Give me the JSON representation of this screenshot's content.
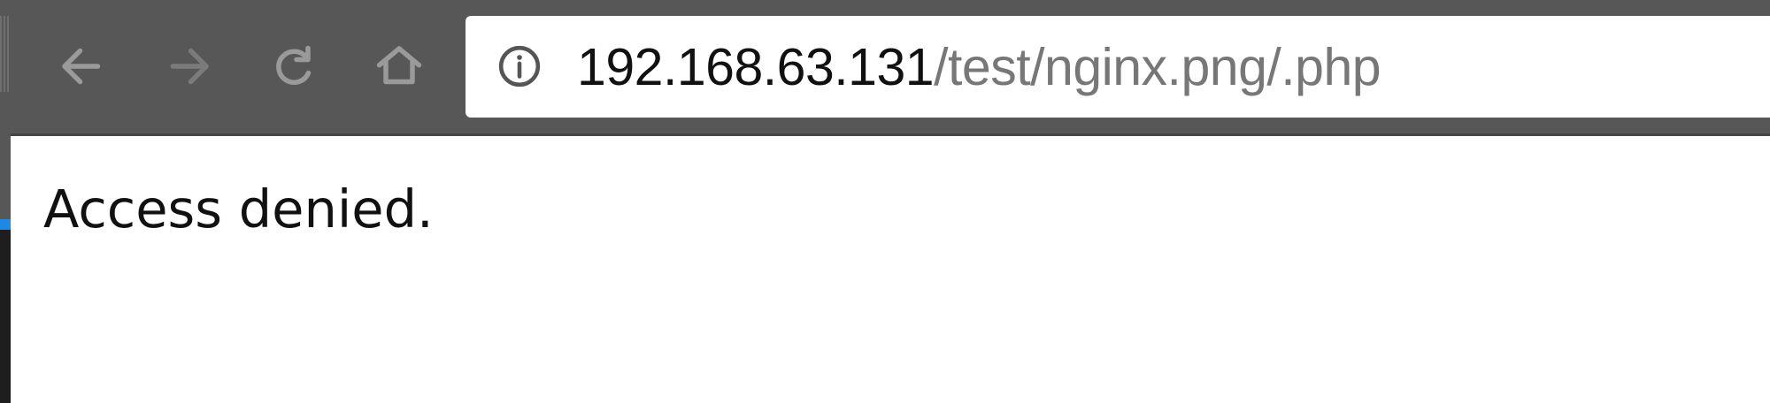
{
  "browser": {
    "toolbar": {
      "buttons": [
        {
          "name": "back",
          "icon": "arrow-left-icon",
          "enabled": true
        },
        {
          "name": "forward",
          "icon": "arrow-right-icon",
          "enabled": false
        },
        {
          "name": "reload",
          "icon": "reload-icon"
        },
        {
          "name": "home",
          "icon": "home-icon"
        }
      ],
      "colors": {
        "toolbar_bg": "#575757",
        "icon_enabled": "#9a9a9a",
        "icon_disabled": "#7b7b7b"
      }
    },
    "address_bar": {
      "security_icon": "info-icon",
      "url_host": "192.168.63.131",
      "url_path": "/test/nginx.png/.php"
    }
  },
  "page": {
    "message": "Access denied."
  }
}
